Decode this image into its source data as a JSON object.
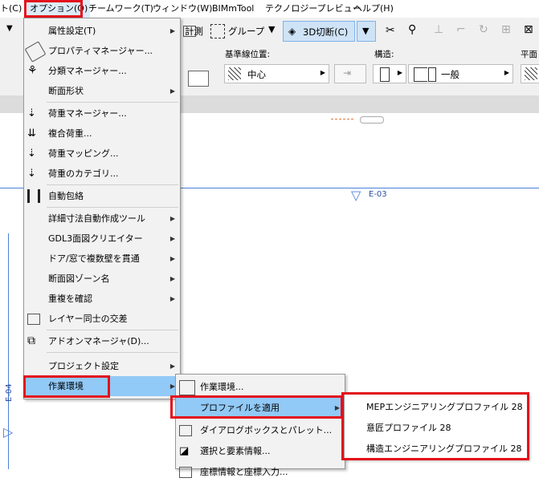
{
  "menubar": {
    "items": [
      {
        "label": "ト(C)"
      },
      {
        "label": "オプション(O)"
      },
      {
        "label": "チームワーク(T)"
      },
      {
        "label": "ウィンドウ(W)"
      },
      {
        "label": "BIMmTool"
      },
      {
        "label": "テクノロジープレビュー"
      },
      {
        "label": "ヘルプ(H)"
      }
    ]
  },
  "toolbar": {
    "measure_label": "計測",
    "group_label": "グループ",
    "cut3d_label": "3D切断(C)"
  },
  "infobox": {
    "ref_line_label": "基準線位置:",
    "ref_line_value": "中心",
    "structure_label": "構造:",
    "structure_value": "一般",
    "plane_label": "平面"
  },
  "canvas": {
    "marker_e03": "E-03",
    "marker_e04": "E-04"
  },
  "options_menu": {
    "items": [
      {
        "label": "属性設定(T)",
        "arrow": "▶"
      },
      {
        "label": "プロパティマネージャー..."
      },
      {
        "label": "分類マネージャー..."
      },
      {
        "label": "断面形状",
        "arrow": "▶"
      },
      {
        "label": "荷重マネージャー..."
      },
      {
        "label": "複合荷重..."
      },
      {
        "label": "荷重マッピング..."
      },
      {
        "label": "荷重のカテゴリ..."
      },
      {
        "label": "自動包絡"
      },
      {
        "label": "詳細寸法自動作成ツール",
        "arrow": "▶"
      },
      {
        "label": "GDL3面図クリエイター",
        "arrow": "▶"
      },
      {
        "label": "ドア/窓で複数壁を貫通",
        "arrow": "▶"
      },
      {
        "label": "断面図ゾーン名",
        "arrow": "▶"
      },
      {
        "label": "重複を確認",
        "arrow": "▶"
      },
      {
        "label": "レイヤー同士の交差"
      },
      {
        "label": "アドオンマネージャ(D)..."
      },
      {
        "label": "プロジェクト設定",
        "arrow": "▶"
      },
      {
        "label": "作業環境",
        "arrow": "▶"
      }
    ]
  },
  "work_env_menu": {
    "items": [
      {
        "label": "作業環境..."
      },
      {
        "label": "プロファイルを適用",
        "arrow": "▶"
      },
      {
        "label": "ダイアログボックスとパレット...",
        "arrow": "▶"
      },
      {
        "label": "選択と要素情報..."
      },
      {
        "label": "座標情報と座標入力..."
      }
    ]
  },
  "profile_menu": {
    "items": [
      {
        "label": "MEPエンジニアリングプロファイル 28"
      },
      {
        "label": "意匠プロファイル 28"
      },
      {
        "label": "構造エンジニアリングプロファイル 28"
      }
    ]
  },
  "colors": {
    "highlight": "#91c9f7",
    "annotation_red": "#e3111b",
    "grid_blue": "#4a7fd6"
  }
}
